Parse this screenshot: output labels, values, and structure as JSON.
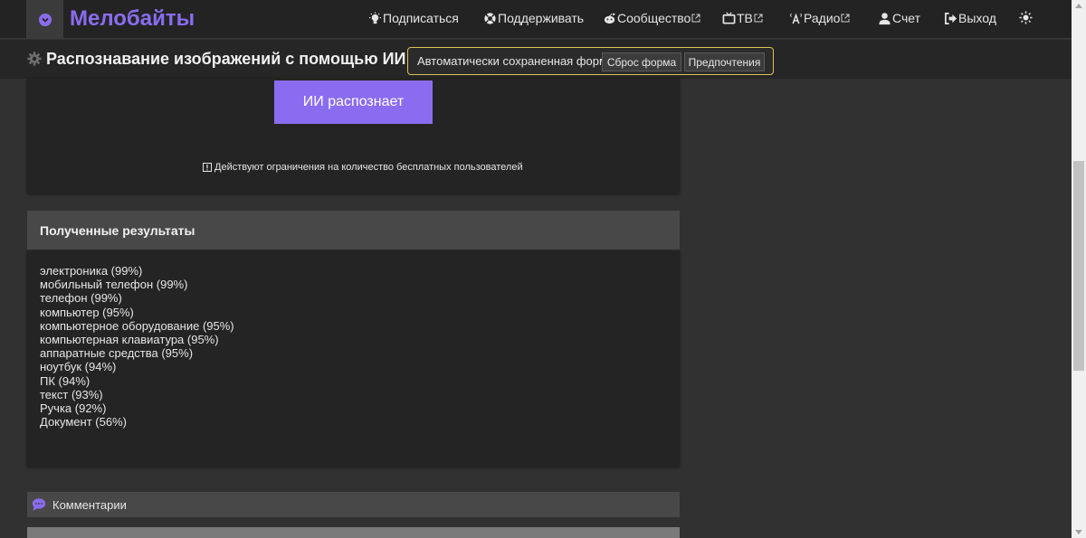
{
  "colors": {
    "accent": "#8a6cf0",
    "autosave_border": "#d8c45a",
    "bg": "#313131"
  },
  "brand": "Мелобайты",
  "nav": {
    "subscribe": "Подписаться",
    "support": "Поддерживать",
    "community": "Сообщество",
    "tv": "ТВ",
    "radio": "Радио",
    "account": "Счет",
    "logout": "Выход"
  },
  "subheader": {
    "title": "Распознавание изображений с помощью ИИ",
    "autosave_text": "Автоматически сохраненная форма",
    "reset_label": "Сброс форма",
    "prefs_label": "Предпочтения"
  },
  "form": {
    "recognize_label": "ИИ распознает",
    "limit_note": "Действуют ограничения на количество бесплатных пользователей"
  },
  "results": {
    "title": "Полученные результаты",
    "items": [
      "электроника (99%)",
      "мобильный телефон (99%)",
      "телефон (99%)",
      "компьютер (95%)",
      "компьютерное оборудование (95%)",
      "компьютерная клавиатура (95%)",
      "аппаратные средства (95%)",
      "ноутбук (94%)",
      "ПК (94%)",
      "текст (93%)",
      "Ручка (92%)",
      "Документ (56%)"
    ]
  },
  "comments": {
    "label": "Комментарии"
  }
}
